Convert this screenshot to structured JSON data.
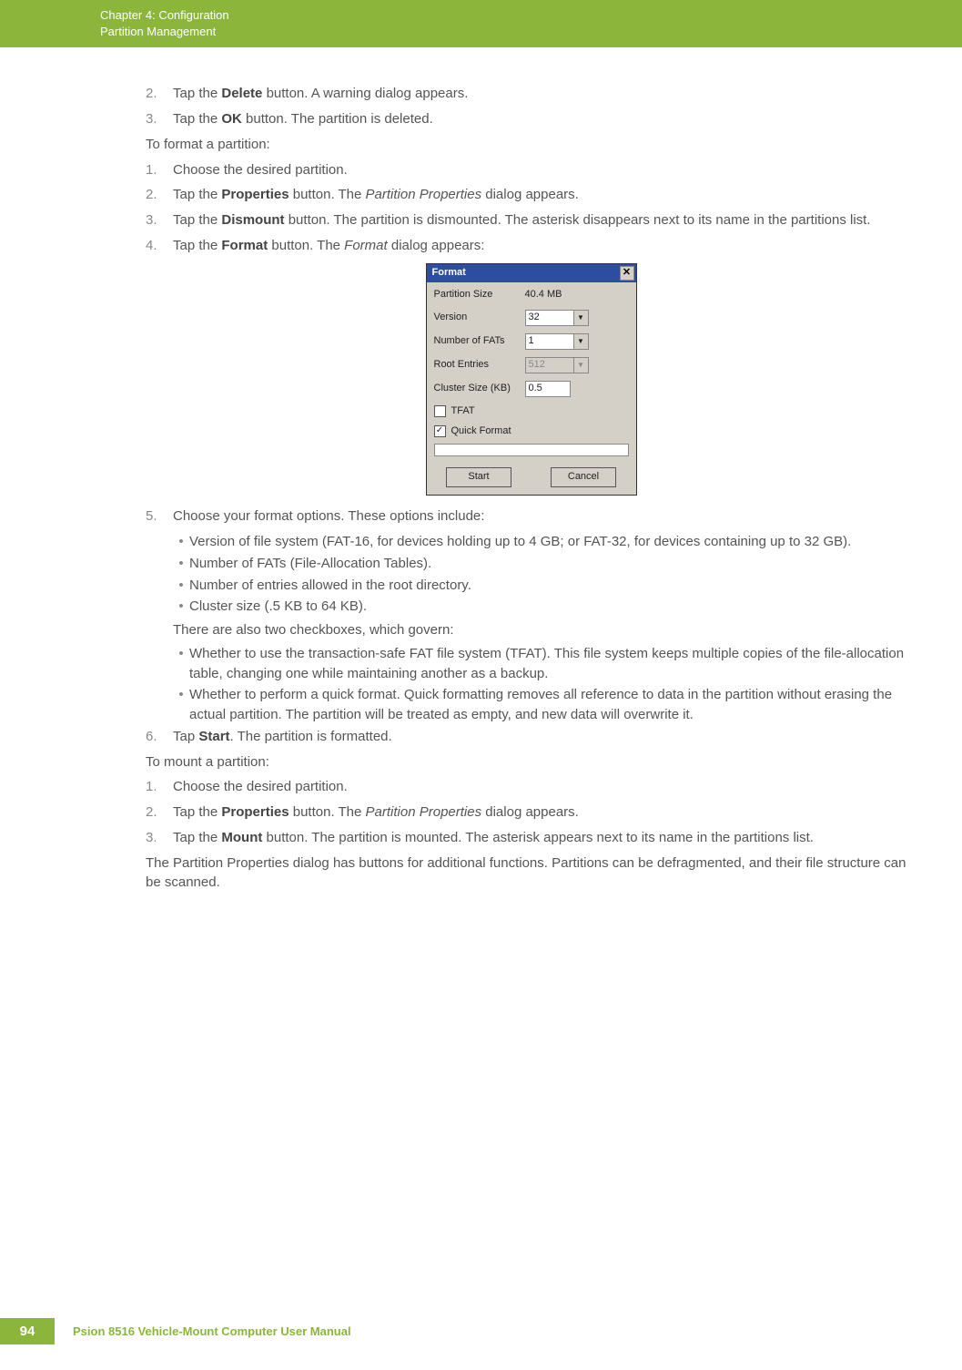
{
  "header": {
    "line1": "Chapter 4:  Configuration",
    "line2": "Partition Management"
  },
  "body": {
    "s1": {
      "n": "2.",
      "t1": "Tap the ",
      "b": "Delete",
      "t2": " button. A warning dialog appears."
    },
    "s2": {
      "n": "3.",
      "t1": "Tap the ",
      "b": "OK",
      "t2": " button. The partition is deleted."
    },
    "p1": "To format a partition:",
    "s3": {
      "n": "1.",
      "t": "Choose the desired partition."
    },
    "s4": {
      "n": "2.",
      "t1": "Tap the ",
      "b": "Properties",
      "t2": " button. The ",
      "i": "Partition Properties",
      "t3": " dialog appears."
    },
    "s5": {
      "n": "3.",
      "t1": "Tap the ",
      "b": "Dismount",
      "t2": " button. The partition is dismounted. The asterisk disappears next to its name in the partitions list."
    },
    "s6": {
      "n": "4.",
      "t1": "Tap the ",
      "b": "Format",
      "t2": " button. The ",
      "i": "Format",
      "t3": " dialog appears:"
    },
    "dialog": {
      "title": "Format",
      "partSizeLbl": "Partition Size",
      "partSizeVal": "40.4 MB",
      "versionLbl": "Version",
      "versionVal": "32",
      "numFatsLbl": "Number of FATs",
      "numFatsVal": "1",
      "rootEntriesLbl": "Root Entries",
      "rootEntriesVal": "512",
      "clusterLbl": "Cluster Size (KB)",
      "clusterVal": "0.5",
      "tfatLbl": "TFAT",
      "quickLbl": "Quick Format",
      "startBtn": "Start",
      "cancelBtn": "Cancel"
    },
    "s7": {
      "n": "5.",
      "t": "Choose your format options. These options include:"
    },
    "b1": "Version of file system (FAT-16, for devices holding up to 4 GB; or FAT-32, for devices containing up to 32 GB).",
    "b2": "Number of FATs (File-Allocation Tables).",
    "b3": "Number of entries allowed in the root directory.",
    "b4": "Cluster size (.5 KB to 64 KB).",
    "p2": "There are also two checkboxes, which govern:",
    "b5": "Whether to use the transaction-safe FAT file system (TFAT). This file system keeps multiple copies of the file-allocation table, changing one while maintaining another as a backup.",
    "b6": "Whether to perform a quick format. Quick formatting removes all reference to data in the partition without erasing the actual partition. The partition will be treated as empty, and new data will overwrite it.",
    "s8": {
      "n": "6.",
      "t1": "Tap ",
      "b": "Start",
      "t2": ". The partition is formatted."
    },
    "p3": "To mount a partition:",
    "s9": {
      "n": "1.",
      "t": "Choose the desired partition."
    },
    "s10": {
      "n": "2.",
      "t1": "Tap the ",
      "b": "Properties",
      "t2": " button. The ",
      "i": "Partition Properties",
      "t3": " dialog appears."
    },
    "s11": {
      "n": "3.",
      "t1": "Tap the ",
      "b": "Mount",
      "t2": " button. The partition is mounted. The asterisk appears next to its name in the partitions list."
    },
    "p4": "The Partition Properties dialog has buttons for additional functions. Partitions can be defragmented, and their file structure can be scanned."
  },
  "footer": {
    "page": "94",
    "manual": "Psion 8516 Vehicle-Mount Computer User Manual"
  }
}
